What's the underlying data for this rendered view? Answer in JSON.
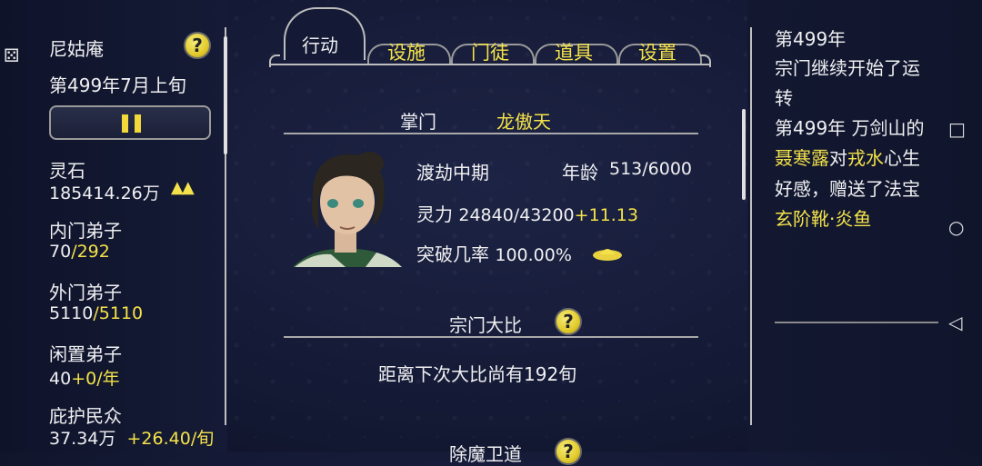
{
  "colors": {
    "accent_yellow": "#f4e24a",
    "panel_bg": "#141a35",
    "line_gray": "#a9a9a9"
  },
  "left_panel": {
    "sect_name": "尼姑庵",
    "date": "第499年7月上旬",
    "stats": [
      {
        "label": "灵石",
        "value": "185414.26万",
        "extra": "▲▲"
      },
      {
        "label": "内门弟子",
        "value_white": "70",
        "value_yellow": "/292"
      },
      {
        "label": "外门弟子",
        "value_white": "5110",
        "value_yellow": "/5110"
      },
      {
        "label": "闲置弟子",
        "value_white": "40",
        "value_yellow": "+0/年"
      },
      {
        "label": "庇护民众",
        "value_white": "37.34万",
        "value_yellow": "+26.40/旬"
      }
    ]
  },
  "tabs": [
    {
      "label": "行动",
      "active": true
    },
    {
      "label": "设施"
    },
    {
      "label": "门徒"
    },
    {
      "label": "道具"
    },
    {
      "label": "设置"
    }
  ],
  "leader": {
    "title_label": "掌门",
    "name": "龙傲天",
    "realm": "渡劫中期",
    "age_label": "年龄",
    "age_value": "513/6000",
    "spirit_label": "灵力",
    "spirit_value": "24840/43200",
    "spirit_gain": "+11.13",
    "breakthrough_label": "突破几率",
    "breakthrough_value": "100.00%"
  },
  "tournament": {
    "title": "宗门大比",
    "countdown": "距离下次大比尚有192旬"
  },
  "next_section": {
    "title": "除魔卫道"
  },
  "log": [
    {
      "segments": [
        {
          "t": "第499年",
          "c": "w"
        }
      ]
    },
    {
      "segments": [
        {
          "t": "宗门继续开始了运",
          "c": "w"
        }
      ]
    },
    {
      "segments": [
        {
          "t": "转",
          "c": "w"
        }
      ]
    },
    {
      "segments": [
        {
          "t": "第499年 万剑山的",
          "c": "w"
        }
      ]
    },
    {
      "segments": [
        {
          "t": "聂寒露",
          "c": "y"
        },
        {
          "t": "对",
          "c": "w"
        },
        {
          "t": "戎水",
          "c": "y"
        },
        {
          "t": "心生",
          "c": "w"
        }
      ]
    },
    {
      "segments": [
        {
          "t": "好感，赠送了法宝",
          "c": "w"
        }
      ]
    },
    {
      "segments": [
        {
          "t": "玄阶靴·炎鱼",
          "c": "y"
        }
      ]
    }
  ],
  "icons": {
    "help": "?",
    "pause": "pause-icon",
    "nav_square": "□",
    "nav_circle": "○",
    "nav_back": "◁",
    "top_left": "⚄"
  }
}
